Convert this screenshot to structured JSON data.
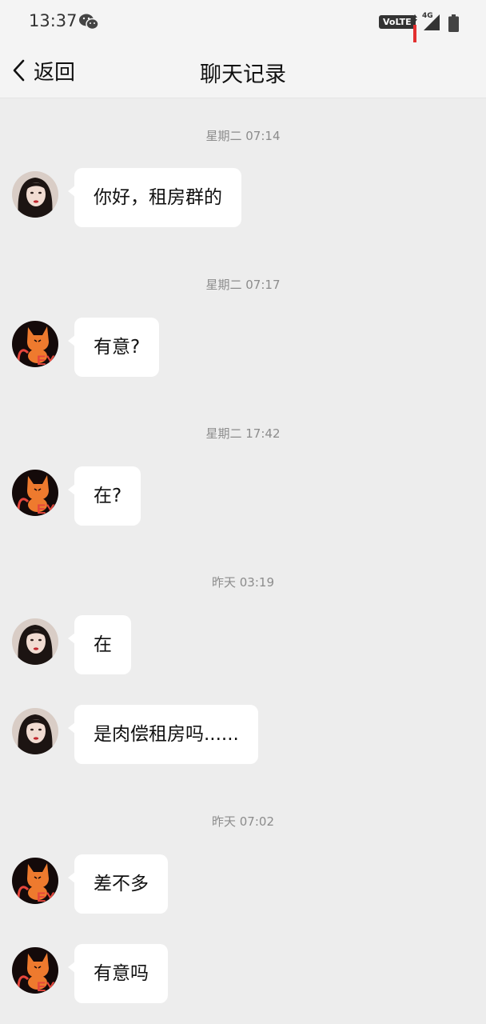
{
  "status_bar": {
    "time": "13:37",
    "volte": "VoLTE",
    "network": "4G"
  },
  "nav": {
    "back_label": "返回",
    "title": "聊天记录"
  },
  "messages": [
    {
      "timestamp": "星期二 07:14",
      "sender": "woman-avatar",
      "text": "你好，租房群的"
    },
    {
      "timestamp": "星期二 07:17",
      "sender": "cat-avatar",
      "text": "有意?"
    },
    {
      "timestamp": "星期二 17:42",
      "sender": "cat-avatar",
      "text": "在?"
    },
    {
      "timestamp": "昨天 03:19",
      "sender": "woman-avatar",
      "text": "在"
    },
    {
      "sender": "woman-avatar",
      "text": "是肉偿租房吗......"
    },
    {
      "timestamp": "昨天 07:02",
      "sender": "cat-avatar",
      "text": "差不多"
    },
    {
      "sender": "cat-avatar",
      "text": "有意吗"
    }
  ],
  "colors": {
    "background": "#ededed",
    "bubble": "#ffffff",
    "timestamp_text": "#8c8c8c"
  }
}
